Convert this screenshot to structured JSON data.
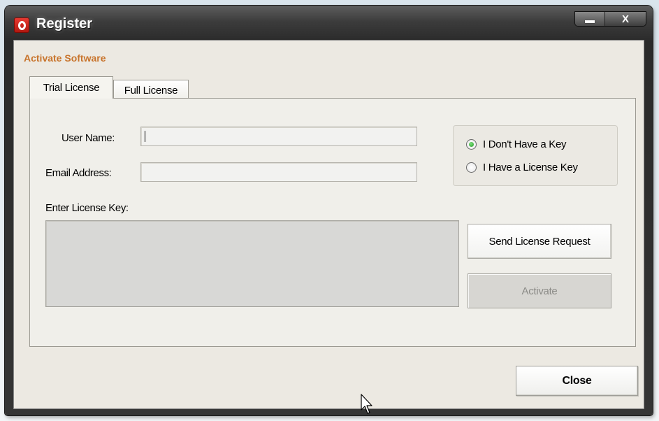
{
  "window": {
    "title": "Register",
    "heading": "Activate Software"
  },
  "tabs": [
    {
      "label": "Trial License",
      "selected": true
    },
    {
      "label": "Full License",
      "selected": false
    }
  ],
  "form": {
    "user_name_label": "User Name:",
    "user_name_value": "",
    "email_label": "Email Address:",
    "email_value": "",
    "license_key_label": "Enter License Key:",
    "license_key_value": ""
  },
  "options": {
    "no_key_label": "I Don't Have a Key",
    "no_key_selected": true,
    "have_key_label": "I Have a License Key",
    "have_key_selected": false
  },
  "buttons": {
    "send_request": "Send License Request",
    "activate": "Activate",
    "activate_enabled": false,
    "close": "Close"
  },
  "icons": {
    "app": "app-logo-icon",
    "minimize": "minimize-icon",
    "close": "close-icon",
    "cursor": "mouse-cursor-icon"
  },
  "colors": {
    "heading": "#c8742c",
    "radio_selected": "#2a9a2a",
    "client_bg": "#ece9e2"
  }
}
